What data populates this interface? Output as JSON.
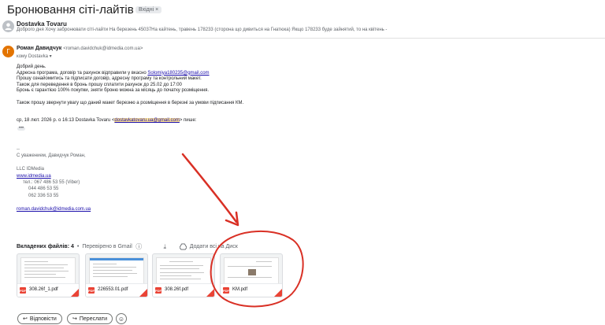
{
  "email": {
    "subject": "Бронювання сіті-лайтів",
    "label": "Вхідні",
    "label_close": "×",
    "first_message": {
      "avatar_letter": "",
      "sender": "Dostavka Tovaru",
      "snippet": "Доброго дня Хочу забронювати сіті-лайти На березень 45037На кайтень, травень 178233 (сторона що дивиться на Гнатюка) Якщо 178233 буде зайнятий, то на квітень -"
    },
    "second_message": {
      "avatar_letter": "Г",
      "sender_name": "Роман Давидчук",
      "sender_email": "<roman.davidchuk@idmedia.com.ua>",
      "recipient": "кому Dostavka",
      "recipient_chevron": "▾",
      "body": {
        "greeting": "Добрий день.",
        "line1_prefix": "Адресна програма, договір та рахунок відправили у вкасно ",
        "line1_link": "Solomiya180235@gmail.com",
        "line2": "Прошу ознайомитись та підписати договір, адресну програму та контрольний макет.",
        "line3": "Також для переведення в бронь прошу сплатити рахунок до 25.02 до 17:00",
        "line4": "Бронь є гарантією 100% покупки, зняти броню можна за місяць до початку розміщення.",
        "line5": "Також прошу звернути увагу що даний макет березню а розміщення в березні за умови підписання КМ.",
        "quote_prefix": "ср, 18 лют. 2026 р. о 16:13 Dostavka Tovaru <",
        "quote_email": "dostavkatovaru.ua@gmail.com",
        "quote_suffix": "> пише:",
        "ellipsis": "•••"
      },
      "signature": {
        "dash": "--",
        "regards": "С уважением, Давидчук Роман,",
        "company": "LLC IDMedia",
        "site": "www.idmedia.ua",
        "phone1": "тел.: 067 486 53 55 (Viber)",
        "phone2": "044 486 53 55",
        "phone3": "062 336 53 55",
        "email": "roman.davidchuk@idmedia.com.ua"
      }
    },
    "attachments": {
      "header_label": "Вкладених файлів: 4",
      "separator": "•",
      "scanned": "Перевірено в Gmail",
      "info_icon": "ⓘ",
      "download_icon": "⤓",
      "save_all": "Додати всі на Диск",
      "files": [
        {
          "name": "308.26f_1.pdf",
          "badge": "PDF"
        },
        {
          "name": "226553.01.pdf",
          "badge": "PDF"
        },
        {
          "name": "308.26f.pdf",
          "badge": "PDF"
        },
        {
          "name": "KM.pdf",
          "badge": "PDF"
        }
      ]
    },
    "actions": {
      "reply": "Відповісти",
      "reply_icon": "↩",
      "forward": "Переслати",
      "forward_icon": "↪",
      "emoji_icon": "☺"
    }
  },
  "colors": {
    "annotation_red": "#d93025",
    "link": "#1a0dab",
    "highlight": "#fde293"
  }
}
